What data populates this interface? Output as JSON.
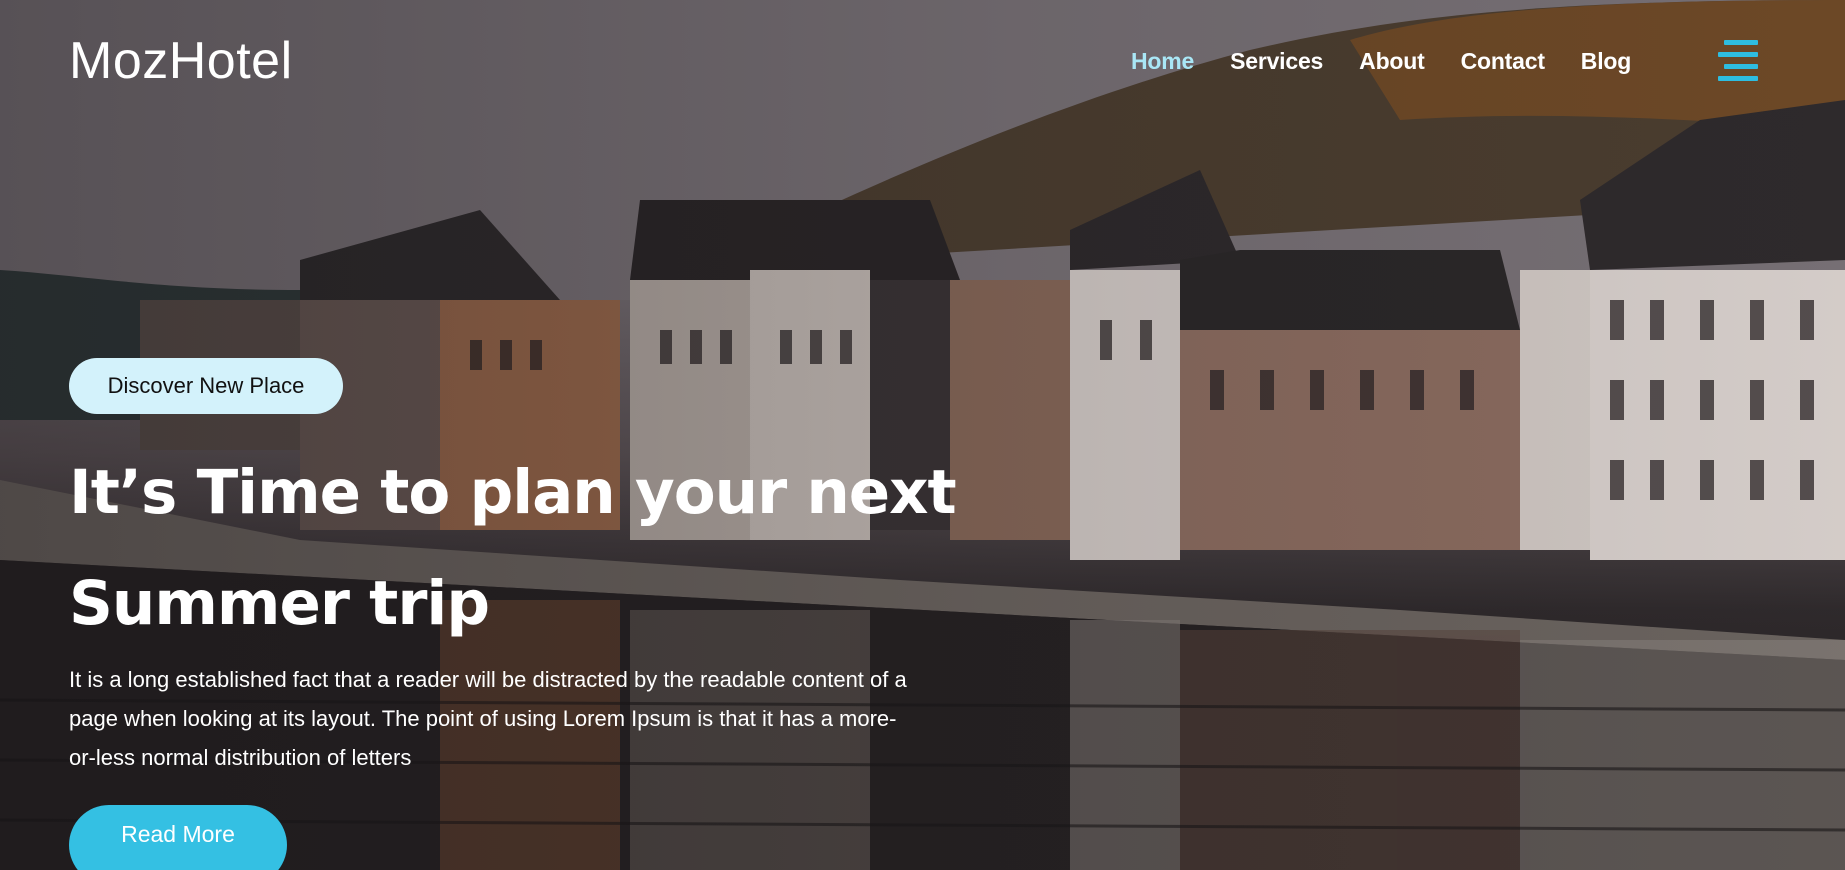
{
  "brand": {
    "name": "MozHotel"
  },
  "nav": {
    "items": [
      {
        "label": "Home",
        "active": true
      },
      {
        "label": "Services",
        "active": false
      },
      {
        "label": "About",
        "active": false
      },
      {
        "label": "Contact",
        "active": false
      },
      {
        "label": "Blog",
        "active": false
      }
    ],
    "menu_icon": "hamburger-menu-icon"
  },
  "hero": {
    "badge": "Discover New Place",
    "headline_line1": "It’s Time to plan your next",
    "headline_line2": "Summer trip",
    "lead": "It is a long established fact that a reader will be distracted by the readable content of a page when looking at its layout. The point of using Lorem Ipsum is that it has a more-or-less normal distribution of letters",
    "cta": "Read More",
    "background": "riverside-town-photo"
  },
  "colors": {
    "accent": "#34c0e3",
    "nav_active": "#a9e7f6",
    "badge_bg": "#d3f2fb",
    "text": "#ffffff"
  }
}
